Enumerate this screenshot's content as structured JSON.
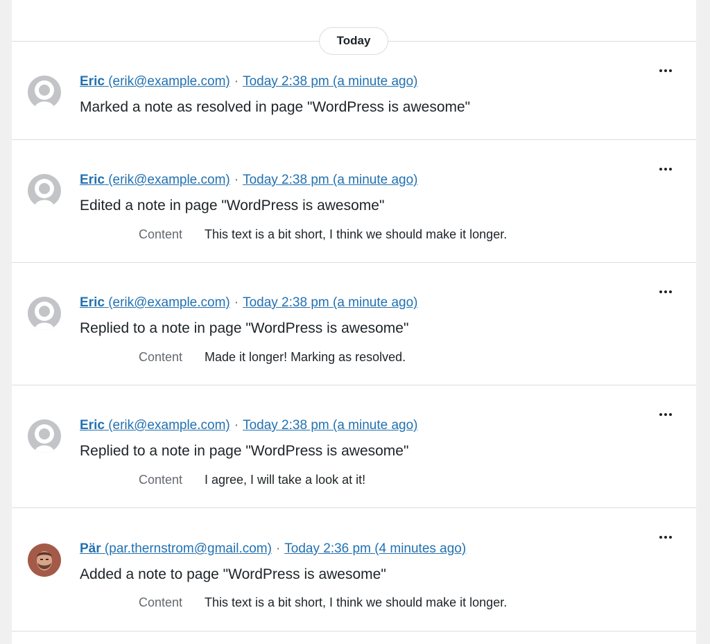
{
  "day_label": "Today",
  "entries": [
    {
      "author_name": "Eric",
      "author_email": "(erik@example.com)",
      "separator": "·",
      "time": "Today 2:38 pm (a minute ago)",
      "action": "Marked a note as resolved in page \"WordPress is awesome\"",
      "avatar": "default-avatar-icon"
    },
    {
      "author_name": "Eric",
      "author_email": "(erik@example.com)",
      "separator": "·",
      "time": "Today 2:38 pm (a minute ago)",
      "action": "Edited a note in page \"WordPress is awesome\"",
      "detail_label": "Content",
      "detail_value": "This text is a bit short, I think we should make it longer.",
      "avatar": "default-avatar-icon"
    },
    {
      "author_name": "Eric",
      "author_email": "(erik@example.com)",
      "separator": "·",
      "time": "Today 2:38 pm (a minute ago)",
      "action": "Replied to a note in page \"WordPress is awesome\"",
      "detail_label": "Content",
      "detail_value": "Made it longer! Marking as resolved.",
      "avatar": "default-avatar-icon"
    },
    {
      "author_name": "Eric",
      "author_email": "(erik@example.com)",
      "separator": "·",
      "time": "Today 2:38 pm (a minute ago)",
      "action": "Replied to a note in page \"WordPress is awesome\"",
      "detail_label": "Content",
      "detail_value": "I agree, I will take a look at it!",
      "avatar": "default-avatar-icon"
    },
    {
      "author_name": "Pär",
      "author_email": "(par.thernstrom@gmail.com)",
      "separator": "·",
      "time": "Today 2:36 pm (4 minutes ago)",
      "action": "Added a note to page \"WordPress is awesome\"",
      "detail_label": "Content",
      "detail_value": "This text is a bit short, I think we should make it longer.",
      "avatar": "user-photo-avatar"
    }
  ],
  "colors": {
    "link": "#2271b1",
    "text": "#1d2327",
    "muted": "#646970",
    "border": "#dcdcde",
    "avatar_bg": "#c3c4c7"
  }
}
